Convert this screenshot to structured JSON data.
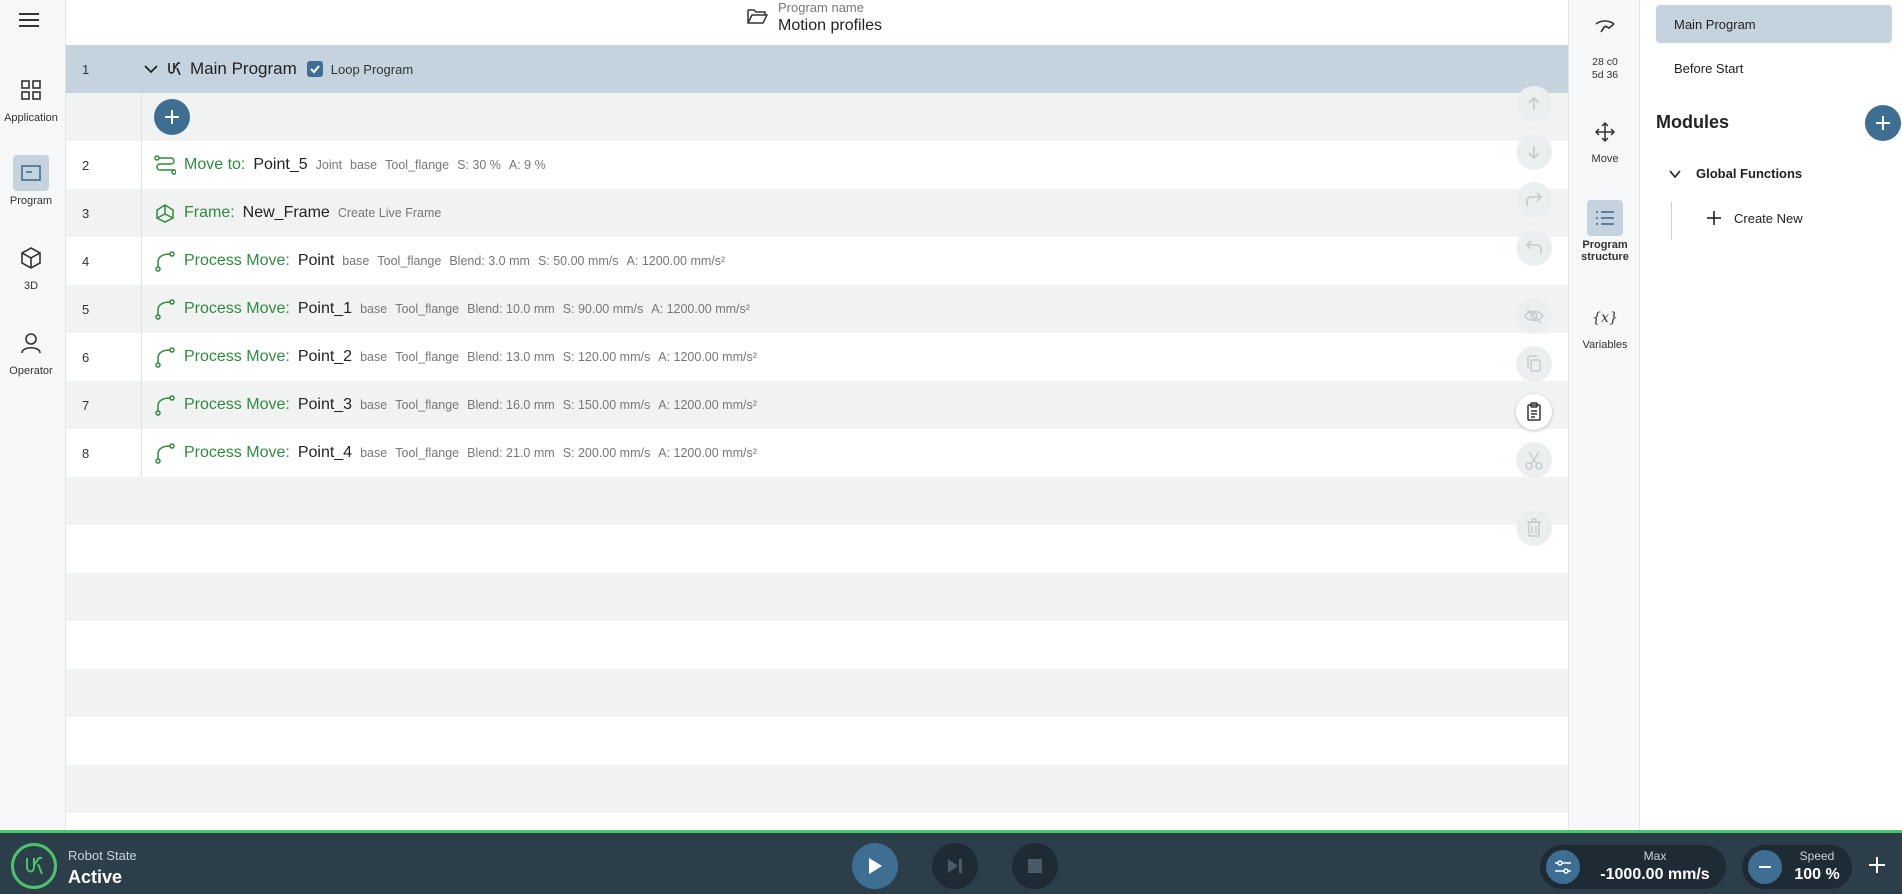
{
  "left_nav": {
    "items": [
      {
        "label": "Application"
      },
      {
        "label": "Program"
      },
      {
        "label": "3D"
      },
      {
        "label": "Operator"
      }
    ]
  },
  "header": {
    "program_name_label": "Program name",
    "program_name": "Motion profiles"
  },
  "program": {
    "main": {
      "number": "1",
      "title": "Main Program",
      "loop_label": "Loop Program",
      "loop_checked": true
    },
    "rows": [
      {
        "number": "2",
        "type": "Move to:",
        "name": "Point_5",
        "attrs": [
          "Joint",
          "base",
          "Tool_flange",
          "S: 30 %",
          "A: 9 %"
        ]
      },
      {
        "number": "3",
        "type": "Frame:",
        "name": "New_Frame",
        "attrs": [
          "Create Live Frame"
        ]
      },
      {
        "number": "4",
        "type": "Process Move:",
        "name": "Point",
        "attrs": [
          "base",
          "Tool_flange",
          "Blend: 3.0 mm",
          "S: 50.00 mm/s",
          "A: 1200.00 mm/s²"
        ]
      },
      {
        "number": "5",
        "type": "Process Move:",
        "name": "Point_1",
        "attrs": [
          "base",
          "Tool_flange",
          "Blend: 10.0 mm",
          "S: 90.00 mm/s",
          "A: 1200.00 mm/s²"
        ]
      },
      {
        "number": "6",
        "type": "Process Move:",
        "name": "Point_2",
        "attrs": [
          "base",
          "Tool_flange",
          "Blend: 13.0 mm",
          "S: 120.00 mm/s",
          "A: 1200.00 mm/s²"
        ]
      },
      {
        "number": "7",
        "type": "Process Move:",
        "name": "Point_3",
        "attrs": [
          "base",
          "Tool_flange",
          "Blend: 16.0 mm",
          "S: 150.00 mm/s",
          "A: 1200.00 mm/s²"
        ]
      },
      {
        "number": "8",
        "type": "Process Move:",
        "name": "Point_4",
        "attrs": [
          "base",
          "Tool_flange",
          "Blend: 21.0 mm",
          "S: 200.00 mm/s",
          "A: 1200.00 mm/s²"
        ]
      }
    ]
  },
  "tool_strip": {
    "robot_id_line1": "28 c0",
    "robot_id_line2": "5d 36",
    "move_label": "Move",
    "structure_label_1": "Program",
    "structure_label_2": "structure",
    "variables_label": "Variables",
    "variables_glyph": "{x}"
  },
  "right_panel": {
    "tabs": [
      {
        "label": "Main Program"
      },
      {
        "label": "Before Start"
      }
    ],
    "modules_title": "Modules",
    "global_functions": "Global Functions",
    "create_new": "Create New"
  },
  "bottom_bar": {
    "robot_state_label": "Robot State",
    "robot_state_value": "Active",
    "max_label": "Max",
    "max_value": "-1000.00 mm/s",
    "speed_label": "Speed",
    "speed_value": "100 %"
  },
  "colors": {
    "accent": "#3e6f92",
    "selected": "#c5d3de",
    "command_green": "#2e8b3e",
    "status_green": "#4bc46b",
    "bottom_bar": "#2c3e4a"
  }
}
